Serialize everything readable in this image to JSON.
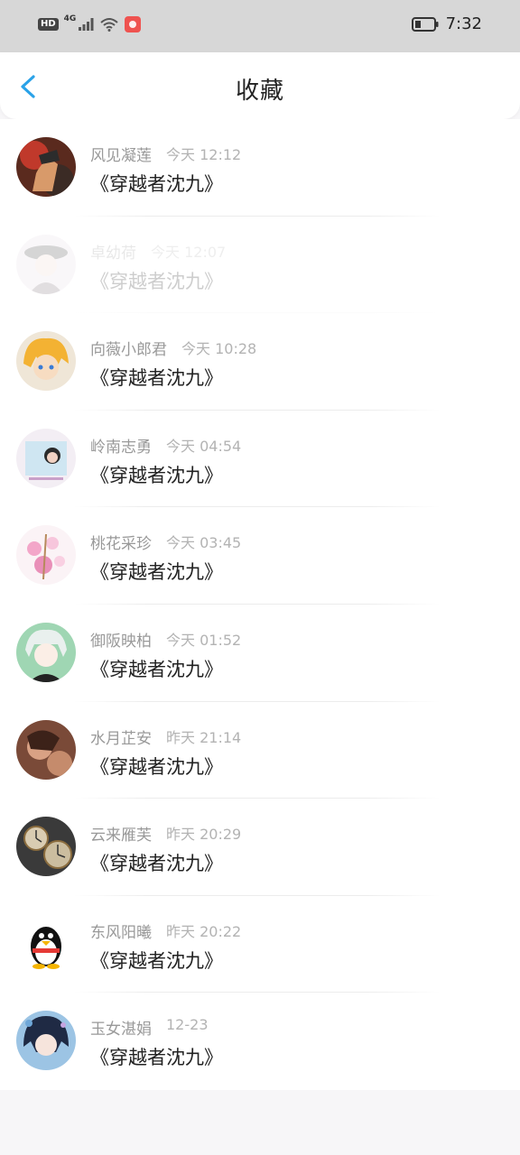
{
  "status_bar": {
    "hd": "HD",
    "network": "4G",
    "time": "7:32"
  },
  "header": {
    "title": "收藏",
    "back_icon": "chevron-left-icon",
    "accent": "#2aa2e8"
  },
  "items": [
    {
      "name": "风见凝莲",
      "time": "今天 12:12",
      "book": "《穿越者沈九》",
      "avatar_icon": "avatar-warrior",
      "dimmed": false
    },
    {
      "name": "卓幼荷",
      "time": "今天 12:07",
      "book": "《穿越者沈九》",
      "avatar_icon": "avatar-hat-girl",
      "dimmed": true
    },
    {
      "name": "向薇小郎君",
      "time": "今天 10:28",
      "book": "《穿越者沈九》",
      "avatar_icon": "avatar-blonde-anime",
      "dimmed": false
    },
    {
      "name": "岭南志勇",
      "time": "今天 04:54",
      "book": "《穿越者沈九》",
      "avatar_icon": "avatar-girl-photo",
      "dimmed": false
    },
    {
      "name": "桃花采珍",
      "time": "今天 03:45",
      "book": "《穿越者沈九》",
      "avatar_icon": "avatar-flowers",
      "dimmed": false
    },
    {
      "name": "御阪映柏",
      "time": "今天 01:52",
      "book": "《穿越者沈九》",
      "avatar_icon": "avatar-anime-boy",
      "dimmed": false
    },
    {
      "name": "水月芷安",
      "time": "昨天 21:14",
      "book": "《穿越者沈九》",
      "avatar_icon": "avatar-brown-girl",
      "dimmed": false
    },
    {
      "name": "云来雁芙",
      "time": "昨天 20:29",
      "book": "《穿越者沈九》",
      "avatar_icon": "avatar-clocks",
      "dimmed": false
    },
    {
      "name": "东风阳曦",
      "time": "昨天 20:22",
      "book": "《穿越者沈九》",
      "avatar_icon": "avatar-penguin",
      "dimmed": false
    },
    {
      "name": "玉女湛娟",
      "time": "12-23",
      "book": "《穿越者沈九》",
      "avatar_icon": "avatar-dark-anime",
      "dimmed": false
    }
  ]
}
